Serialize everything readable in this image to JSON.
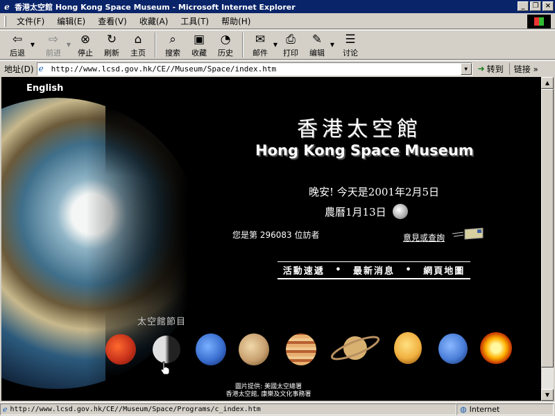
{
  "window": {
    "title": "香港太空館 Hong Kong Space Museum - Microsoft Internet Explorer",
    "buttons": [
      "_",
      "❐",
      "×"
    ]
  },
  "menu": [
    {
      "label": "文件(F)"
    },
    {
      "label": "编辑(E)"
    },
    {
      "label": "查看(V)"
    },
    {
      "label": "收藏(A)"
    },
    {
      "label": "工具(T)"
    },
    {
      "label": "帮助(H)"
    }
  ],
  "toolbar": {
    "back": "后退",
    "forward": "前进",
    "stop": "停止",
    "refresh": "刷新",
    "home": "主页",
    "search": "搜索",
    "favorites": "收藏",
    "history": "历史",
    "mail": "邮件",
    "print": "打印",
    "edit": "编辑",
    "discuss": "讨论"
  },
  "address": {
    "label": "地址(D)",
    "url": "http://www.lcsd.gov.hk/CE//Museum/Space/index.htm",
    "go": "转到",
    "links": "链接"
  },
  "page": {
    "english_link": "English",
    "title_zh": "香港太空館",
    "title_en": "Hong Kong Space Museum",
    "greeting": "晚安! 今天是2001年2月5日",
    "lunar_date": "農曆1月13日",
    "visitor_count": "您是第 296083 位訪者",
    "feedback": "意見或查詢",
    "nav": [
      "活動速遞",
      "•",
      "最新消息",
      "•",
      "網頁地圖"
    ],
    "programmes_title": "太空館節目",
    "credit_line1": "圖片提供: 美國太空總署",
    "credit_line2": "香港太空館, 康樂及文化事務署"
  },
  "planets": [
    {
      "name": "mars-red",
      "color": "#c8321a"
    },
    {
      "name": "moon",
      "color": "#c0c0c0"
    },
    {
      "name": "neptune",
      "color": "#3a6fd0"
    },
    {
      "name": "mercury",
      "color": "#c8a070"
    },
    {
      "name": "jupiter",
      "color": "#d89050"
    },
    {
      "name": "saturn",
      "color": "#d8b070"
    },
    {
      "name": "venus",
      "color": "#f0b040"
    },
    {
      "name": "uranus",
      "color": "#4a7ed8"
    },
    {
      "name": "sun",
      "color": "#ffb000"
    }
  ],
  "status": {
    "url": "http://www.lcsd.gov.hk/CE//Museum/Space/Programs/c_index.htm",
    "zone": "Internet"
  }
}
